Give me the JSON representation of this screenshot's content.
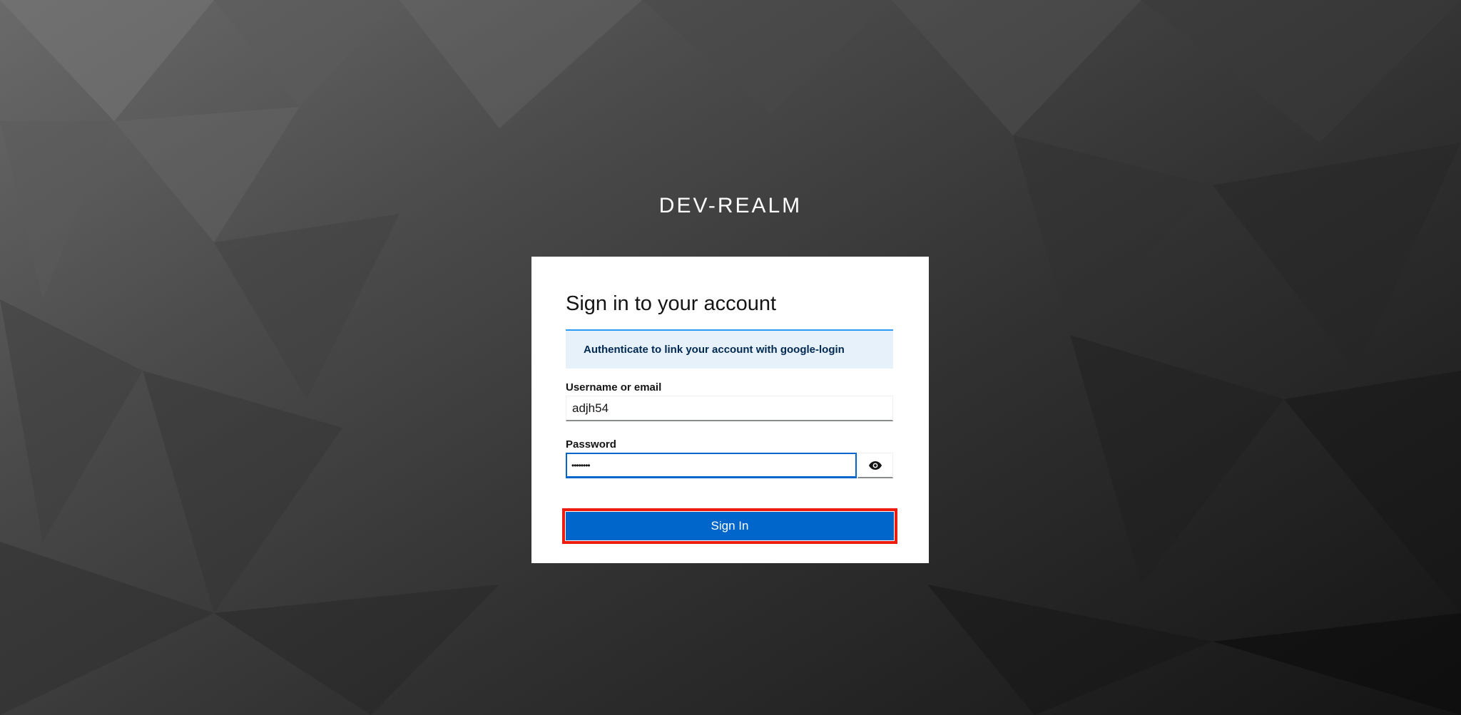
{
  "realm": {
    "title": "DEV-REALM"
  },
  "login": {
    "heading": "Sign in to your account",
    "alert_message": "Authenticate to link your account with google-login",
    "username": {
      "label": "Username or email",
      "value": "adjh54"
    },
    "password": {
      "label": "Password",
      "masked_value": "••••••••"
    },
    "reveal_icon": "eye-icon",
    "submit_label": "Sign In"
  },
  "colors": {
    "primary": "#0066cc",
    "alert_background": "#e7f1fa",
    "alert_border": "#2b9af3",
    "highlight": "#ee1c0e"
  }
}
